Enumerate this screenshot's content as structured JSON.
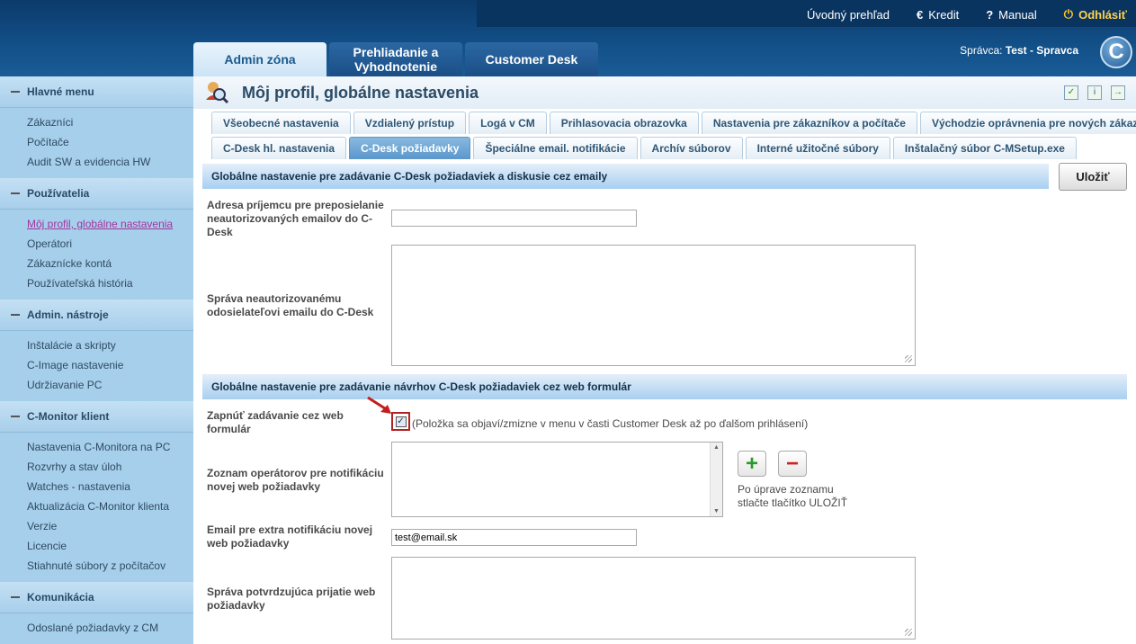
{
  "header": {
    "top_links": [
      {
        "label": "Úvodný prehľad",
        "icon": ""
      },
      {
        "label": "Kredit",
        "icon": "euro-icon"
      },
      {
        "label": "Manual",
        "icon": "help-icon"
      },
      {
        "label": "Odhlásiť",
        "icon": "power-icon"
      }
    ],
    "main_tabs": [
      {
        "label": "Admin zóna",
        "active": true
      },
      {
        "label": "Prehliadanie a Vyhodnotenie",
        "active": false
      },
      {
        "label": "Customer Desk",
        "active": false
      }
    ],
    "user_prefix": "Správca:",
    "user_name": "Test - Spravca"
  },
  "sidebar": {
    "sections": [
      {
        "title": "Hlavné menu",
        "items": [
          "Zákazníci",
          "Počítače",
          "Audit SW a evidencia HW"
        ]
      },
      {
        "title": "Používatelia",
        "items": [
          "Môj profil, globálne nastavenia",
          "Operátori",
          "Zákaznícke kontá",
          "Používateľská história"
        ]
      },
      {
        "title": "Admin. nástroje",
        "items": [
          "Inštalácie a skripty",
          "C-Image nastavenie",
          "Udržiavanie PC"
        ]
      },
      {
        "title": "C-Monitor klient",
        "items": [
          "Nastavenia C-Monitora na PC",
          "Rozvrhy a stav úloh",
          "Watches - nastavenia",
          "Aktualizácia C-Monitor klienta",
          "Verzie",
          "Licencie",
          "Stiahnuté súbory z počítačov"
        ]
      },
      {
        "title": "Komunikácia",
        "items": [
          "Odoslané požiadavky z CM"
        ]
      }
    ],
    "active_item": "Môj profil, globálne nastavenia"
  },
  "page": {
    "title": "Môj profil, globálne nastavenia",
    "tabs_row1": [
      "Všeobecné nastavenia",
      "Vzdialený prístup",
      "Logá v CM",
      "Prihlasovacia obrazovka",
      "Nastavenia pre zákazníkov a počítače",
      "Východzie oprávnenia pre nových zákazníkov"
    ],
    "tabs_row2": [
      "C-Desk hl. nastavenia",
      "C-Desk požiadavky",
      "Špeciálne email. notifikácie",
      "Archív súborov",
      "Interné užitočné súbory",
      "Inštalačný súbor C-MSetup.exe"
    ],
    "active_tab": "C-Desk požiadavky",
    "save_label": "Uložiť"
  },
  "form": {
    "section1_title": "Globálne nastavenie pre zadávanie C-Desk požiadaviek a diskusie cez emaily",
    "recipient_label": "Adresa príjemcu pre preposielanie neautorizovaných emailov do C-Desk",
    "recipient_value": "",
    "unauth_message_label": "Správa neautorizovanému odosielateľovi emailu do C-Desk",
    "section2_title": "Globálne nastavenie pre zadávanie návrhov C-Desk požiadaviek cez web formulár",
    "enable_web_label": "Zapnúť zadávanie cez web formulár",
    "enable_web_checked": true,
    "enable_web_note": "(Položka sa objaví/zmizne v menu v časti Customer Desk až po ďalšom prihlásení)",
    "operators_label": "Zoznam operátorov pre notifikáciu novej web požiadavky",
    "operators_note": "Po úprave zoznamu stlačte tlačítko ULOŽIŤ",
    "extra_email_label": "Email pre extra notifikáciu novej web požiadavky",
    "extra_email_value": "test@email.sk",
    "confirm_label": "Správa potvrdzujúca prijatie web požiadavky"
  },
  "colors": {
    "header_bg": "#125088",
    "sidebar_bg": "#a6cfec",
    "active_link": "#a3359b",
    "accent_tab": "#5b97cb"
  }
}
